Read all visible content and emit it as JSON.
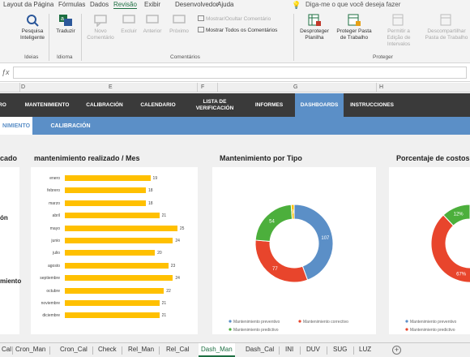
{
  "ribbon_tabs": [
    "Layout da Página",
    "Fórmulas",
    "Dados",
    "Revisão",
    "Exibir",
    "Desenvolvedor",
    "Ajuda"
  ],
  "active_ribbon_tab": "Revisão",
  "tell_me": "Diga-me o que você deseja fazer",
  "ribbon": {
    "smart_lookup": "Pesquisa Inteligente",
    "translate": "Traduzir",
    "new_comment": "Novo Comentário",
    "delete": "Excluir",
    "previous": "Anterior",
    "next": "Próximo",
    "show_hide_comment": "Mostrar/Ocultar Comentário",
    "show_all_comments": "Mostrar Todos os Comentários",
    "unprotect_sheet": "Desproteger Planilha",
    "protect_workbook": "Proteger Pasta de Trabalho",
    "allow_edit_ranges": "Permitir a Edição de Intervalos",
    "unshare_workbook": "Descompartilhar Pasta de Trabalho",
    "groups": {
      "ideas": "Ideias",
      "language": "Idioma",
      "comments": "Comentários",
      "protect": "Proteger"
    }
  },
  "columns": [
    "D",
    "E",
    "F",
    "G",
    "H"
  ],
  "nav": {
    "items": [
      "MANTENIMIENTO",
      "CALIBRACIÓN",
      "CALENDARIO",
      "LISTA DE VERIFICACIÓN",
      "INFORMES",
      "DASHBOARDS",
      "INSTRUCCIONES"
    ],
    "active": "DASHBOARDS"
  },
  "subnav": {
    "tabs": [
      "NIMIENTO",
      "CALIBRACIÓN"
    ],
    "active": "NIMIENTO"
  },
  "left_panel": {
    "title": "cado",
    "label_1": "ón",
    "label_2": "miento"
  },
  "colors": {
    "yellow": "#ffc000",
    "blue": "#5b8fc7",
    "red": "#e8452c",
    "green": "#4caf3c",
    "nav": "#3a3a3a"
  },
  "chart_data": [
    {
      "type": "bar",
      "title": "mantenimiento realizado / Mes",
      "orientation": "horizontal",
      "categories": [
        "enero",
        "febrero",
        "marzo",
        "abril",
        "mayo",
        "junio",
        "julio",
        "agosto",
        "septiembre",
        "octubre",
        "noviembre",
        "diciembre"
      ],
      "values": [
        19,
        18,
        18,
        21,
        25,
        24,
        20,
        23,
        24,
        22,
        21,
        21
      ],
      "xlim": [
        0,
        27
      ],
      "color": "#ffc000"
    },
    {
      "type": "pie",
      "title": "Mantenimiento por Tipo",
      "donut": true,
      "series": [
        {
          "name": "Mantenimiento preventivo",
          "value": 107,
          "color": "#5b8fc7"
        },
        {
          "name": "Mantenimiento correctivo",
          "value": 77,
          "color": "#e8452c"
        },
        {
          "name": "Mantenimiento predictivo",
          "value": 54,
          "color": "#4caf3c"
        },
        {
          "name": "",
          "value": 3,
          "color": "#ffc000"
        }
      ]
    },
    {
      "type": "pie",
      "title": "Porcentaje de costos",
      "donut": true,
      "series": [
        {
          "name": "Mantenimiento preventivo",
          "label": "",
          "value": 21,
          "color": "#5b8fc7"
        },
        {
          "name": "Mantenimiento predictivo",
          "label": "67%",
          "value": 67,
          "color": "#e8452c"
        },
        {
          "name": "",
          "label": "12%",
          "value": 12,
          "color": "#4caf3c"
        }
      ]
    }
  ],
  "sheet_tabs": [
    "Cal",
    "Cron_Man",
    "Cron_Cal",
    "Check",
    "Rel_Man",
    "Rel_Cal",
    "Dash_Man",
    "Dash_Cal",
    "INI",
    "DUV",
    "SUG",
    "LUZ"
  ],
  "active_sheet": "Dash_Man"
}
